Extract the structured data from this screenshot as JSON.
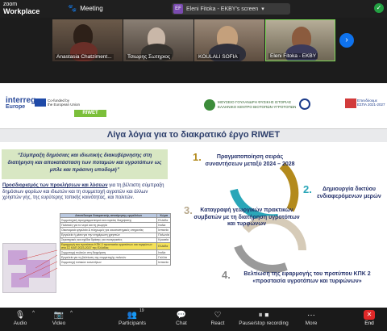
{
  "app": {
    "brand_line1": "zoom",
    "brand_line2": "Workplace"
  },
  "header": {
    "meeting_label": "Meeting",
    "share_initials": "EF",
    "share_label": "Eleni Fitoka - EKBY's screen",
    "share_caret": "▾"
  },
  "participants": [
    {
      "name": "Anastasia Chatziment..."
    },
    {
      "name": "Τσιωρης Σωτηριος"
    },
    {
      "name": "KOULALI SOFIA"
    },
    {
      "name": "Eleni Fitoka - EKBY"
    }
  ],
  "slide": {
    "logo_interreg": "interreg",
    "logo_interreg_sub": "Europe",
    "cofund_text": [
      "Co-funded by",
      "the European Union"
    ],
    "riwet": "RIWET",
    "museum_text": [
      "ΜΟΥΣΕΙΟ ΓΟΥΛΑΝΔΡΗ ΦΥΣΙΚΗΣ ΙΣΤΟΡΙΑΣ",
      "ΕΛΛΗΝΙΚΟ ΚΕΝΤΡΟ ΒΙΟΤΟΠΩΝ-ΥΓΡΟΤΟΠΩΝ"
    ],
    "espa_text": [
      "Επενδύουμε",
      "ΕΣΠΑ 2021-2027"
    ],
    "title": "Λίγα λόγια για το διακρατικό έργο RIWET",
    "quote": "“Σύμπραξη δημόσιας και ιδιωτικής διακυβέρνησης στη διατήρηση και αποκατάσταση των ποταμών και υγροτόπων ως μπλε και πράσινη υποδομή”",
    "para_bold": "Προσδιορισμός των προκλήσεων και λύσεων",
    "para_rest": " για τη βέλτιστη σύμπραξη δημόσιων φορέων και ιδιωτών και τη συμμετοχή αγροτών και άλλων χρηστών γης, της ευρύτερης τοπικής κοινότητας, και πολιτών.",
    "table": {
      "headers": [
        "Αποτέλεσμα διακρατικής αποτίμησης εργαλείων",
        "Χώρα"
      ],
      "rows": [
        {
          "text": "Συμμετοχική προγραμματισμού και ευρείας διαχείρισης",
          "country": "Ελλάδα",
          "hl": false
        },
        {
          "text": "Πολιτικές για το νερό και τη γεωργία",
          "country": "Ιταλία",
          "hl": false
        },
        {
          "text": "Οικονομικά εργαλεία & πληρωμές για οικοσυστημικές υπηρεσίες",
          "country": "Ισπανία",
          "hl": false
        },
        {
          "text": "Εργαλεία ή μέσα για την ενημέρωση χρηστών",
          "country": "Πολωνία",
          "hl": false
        },
        {
          "text": "Στρατηγικές και σχέδια δράσης για συνεργασίες",
          "country": "Κροατία",
          "hl": false
        },
        {
          "text": "Εφαρμογή του προτύπου ΚΠΚ 2 προστασία υγροτόπων και τυρφώνων στα ΣΣ ΚΑΠ 2023-2027 της Ελλάδας",
          "country": "Ελλάδα",
          "hl": true
        },
        {
          "text": "Συμμετοχή πολιτών στη διαχείριση",
          "country": "Ιταλία",
          "hl": false
        },
        {
          "text": "Εργαλεία για τη βελτίωση της συμμετοχής πολιτών",
          "country": "Γαλλία",
          "hl": false
        },
        {
          "text": "Συμμετοχή τοπικών κοινοτήτων",
          "country": "Ισπανία",
          "hl": false
        }
      ]
    },
    "cycle": [
      {
        "num": "1.",
        "num_color": "#b38a1c",
        "text": "Πραγματοποίηση σειράς συναντήσεων μεταξύ 2024 – 2028"
      },
      {
        "num": "2.",
        "num_color": "#2aa6b8",
        "text": "Δημιουργία δικτύου ενδιαφερόμενων μερών"
      },
      {
        "num": "3.",
        "num_color": "#b8a98c",
        "text": "Καταγραφή γεωργικών πρακτικών συμβατών με τη διατήρηση υγροτόπων και τυρφώνων"
      },
      {
        "num": "4.",
        "num_color": "#8a8a8a",
        "text": "Βελτίωση της εφαρμογής του προτύπου ΚΠΚ 2 «προστασία υγροτόπων και τυρφώνων»"
      }
    ]
  },
  "toolbar": {
    "audio": "Audio",
    "video": "Video",
    "participants": "Participants",
    "participants_count": "19",
    "chat": "Chat",
    "react": "React",
    "share": "Pause/stop recording",
    "more": "More",
    "end": "End"
  }
}
